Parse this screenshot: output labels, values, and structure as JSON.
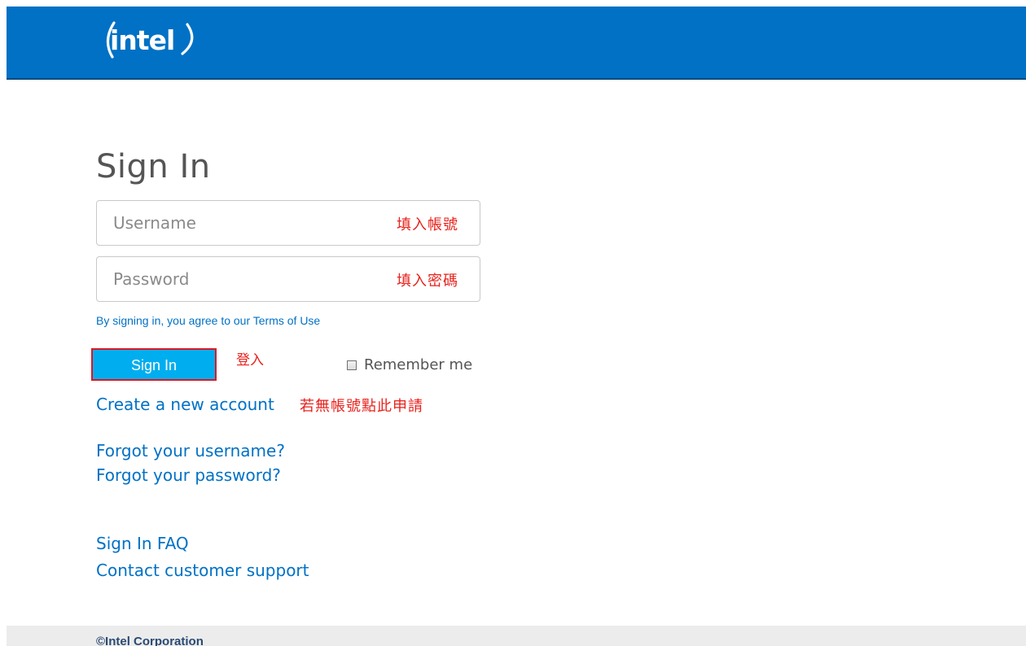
{
  "brand": {
    "logo_text": "intel",
    "header_color": "#0071c5"
  },
  "signin": {
    "title": "Sign In",
    "username_placeholder": "Username",
    "username_note": "填入帳號",
    "password_placeholder": "Password",
    "password_note": "填入密碼",
    "terms_text": "By signing in, you agree to our Terms of Use",
    "button_label": "Sign In",
    "button_note": "登入",
    "remember_label": "Remember me",
    "remember_checked": false
  },
  "links": {
    "create_account": "Create a new account",
    "create_note": "若無帳號點此申請",
    "forgot_username": "Forgot your username?",
    "forgot_password": "Forgot your password?",
    "faq": "Sign In FAQ",
    "support": "Contact customer support"
  },
  "footer": {
    "copyright": "©Intel Corporation"
  },
  "colors": {
    "link": "#0071c5",
    "button": "#00aeef",
    "annotation": "#e8221d",
    "highlight_border": "#e1141f"
  }
}
